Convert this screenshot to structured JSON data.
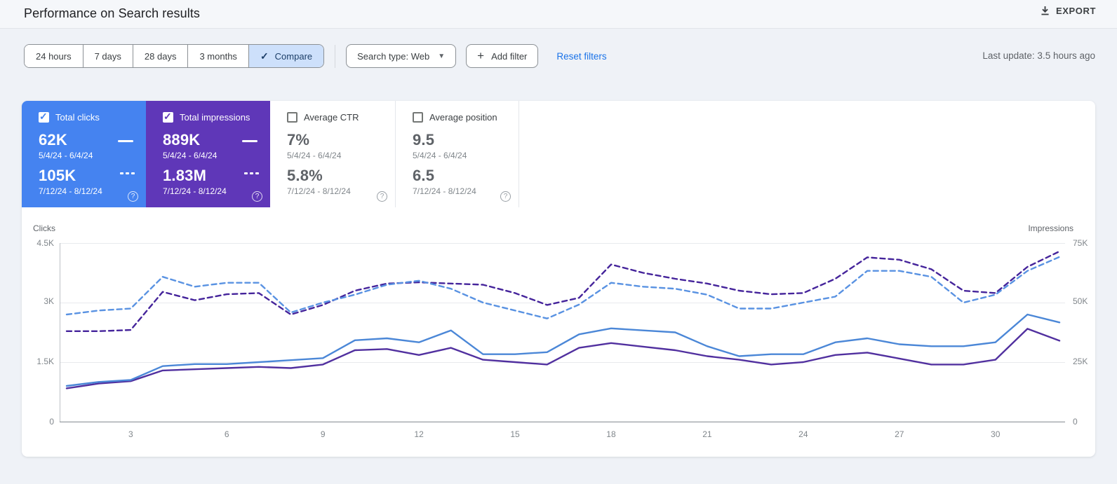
{
  "header": {
    "title": "Performance on Search results",
    "export_label": "EXPORT"
  },
  "filters": {
    "date_ranges": [
      "24 hours",
      "7 days",
      "28 days",
      "3 months"
    ],
    "compare_label": "Compare",
    "search_type": "Search type: Web",
    "add_filter_label": "Add filter",
    "reset_label": "Reset filters",
    "last_update": "Last update: 3.5 hours ago"
  },
  "icons": {
    "check": "✓",
    "plus": "+",
    "caret": "▼",
    "question": "?"
  },
  "metrics": [
    {
      "label": "Total clicks",
      "checked": true,
      "color": "#4583f0",
      "value1": "62K",
      "range1": "5/4/24 - 6/4/24",
      "value2": "105K",
      "range2": "7/12/24 - 8/12/24"
    },
    {
      "label": "Total impressions",
      "checked": true,
      "color": "#5f37b8",
      "value1": "889K",
      "range1": "5/4/24 - 6/4/24",
      "value2": "1.83M",
      "range2": "7/12/24 - 8/12/24"
    },
    {
      "label": "Average CTR",
      "checked": false,
      "color": "#ffffff",
      "value1": "7%",
      "range1": "5/4/24 - 6/4/24",
      "value2": "5.8%",
      "range2": "7/12/24 - 8/12/24"
    },
    {
      "label": "Average position",
      "checked": false,
      "color": "#ffffff",
      "value1": "9.5",
      "range1": "5/4/24 - 6/4/24",
      "value2": "6.5",
      "range2": "7/12/24 - 8/12/24"
    }
  ],
  "chart_data": {
    "type": "line",
    "x_days": [
      1,
      2,
      3,
      4,
      5,
      6,
      7,
      8,
      9,
      10,
      11,
      12,
      13,
      14,
      15,
      16,
      17,
      18,
      19,
      20,
      21,
      22,
      23,
      24,
      25,
      26,
      27,
      28,
      29,
      30,
      31,
      32
    ],
    "x_tick_labels": [
      3,
      6,
      9,
      12,
      15,
      18,
      21,
      24,
      27,
      30
    ],
    "left_axis": {
      "label": "Clicks",
      "ticks": [
        "4.5K",
        "3K",
        "1.5K",
        "0"
      ],
      "max": 4500
    },
    "right_axis": {
      "label": "Impressions",
      "ticks": [
        "75K",
        "50K",
        "25K",
        "0"
      ],
      "max": 75000
    },
    "grid": true,
    "series": [
      {
        "name": "Impressions 7/12/24 - 8/12/24",
        "axis": "right",
        "style": "dashed",
        "color": "#45249b",
        "values": [
          38000,
          38000,
          38500,
          54500,
          51000,
          53500,
          54000,
          45000,
          49000,
          55000,
          58000,
          58500,
          58000,
          57500,
          54000,
          49000,
          52000,
          66000,
          62500,
          60000,
          58000,
          55000,
          53500,
          54000,
          60000,
          69000,
          68000,
          64000,
          55000,
          54000,
          65000,
          71500
        ]
      },
      {
        "name": "Clicks 7/12/24 - 8/12/24",
        "axis": "left",
        "style": "dashed",
        "color": "#5992e2",
        "values": [
          2700,
          2800,
          2850,
          3650,
          3400,
          3500,
          3500,
          2750,
          3000,
          3200,
          3450,
          3550,
          3350,
          3000,
          2800,
          2600,
          2950,
          3500,
          3400,
          3350,
          3200,
          2850,
          2850,
          3000,
          3150,
          3800,
          3800,
          3650,
          3000,
          3200,
          3800,
          4150
        ]
      },
      {
        "name": "Impressions 5/4/24 - 6/4/24",
        "axis": "right",
        "style": "solid",
        "color": "#51309f",
        "values": [
          14000,
          16000,
          17000,
          21500,
          22000,
          22500,
          23000,
          22500,
          24000,
          30000,
          30500,
          28000,
          31000,
          26000,
          25000,
          24000,
          31000,
          33000,
          31500,
          30000,
          27500,
          26000,
          24000,
          25000,
          28000,
          29000,
          26500,
          24000,
          24000,
          26000,
          39000,
          34000
        ]
      },
      {
        "name": "Clicks 5/4/24 - 6/4/24",
        "axis": "left",
        "style": "solid",
        "color": "#4b87d7",
        "values": [
          900,
          1000,
          1050,
          1400,
          1450,
          1450,
          1500,
          1550,
          1600,
          2050,
          2100,
          2000,
          2300,
          1700,
          1700,
          1750,
          2200,
          2350,
          2300,
          2250,
          1900,
          1650,
          1700,
          1700,
          2000,
          2100,
          1950,
          1900,
          1900,
          2000,
          2700,
          2500
        ]
      }
    ]
  }
}
